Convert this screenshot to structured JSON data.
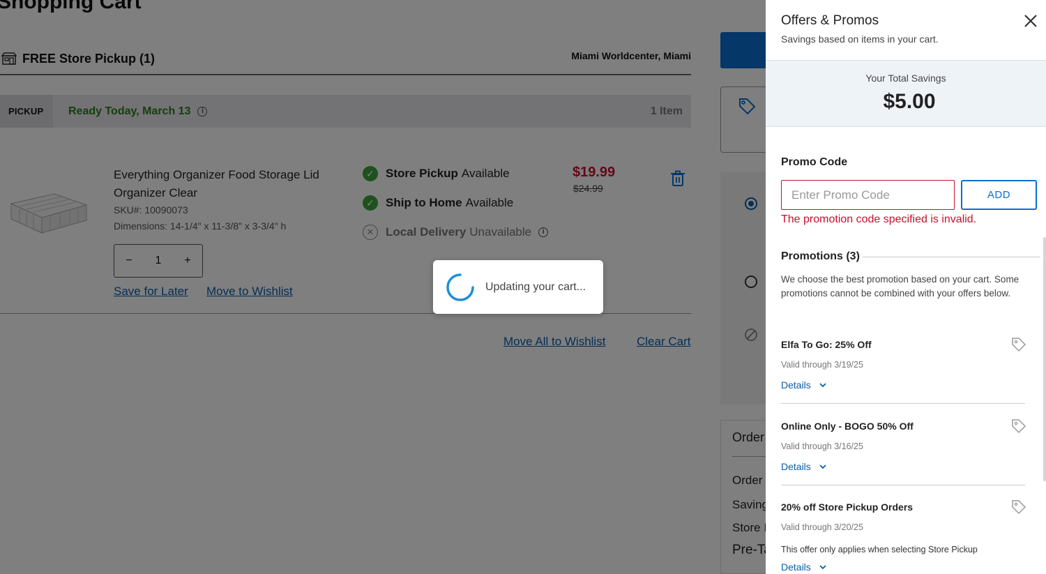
{
  "page": {
    "title": "Shopping Cart",
    "pickup_title": "FREE Store Pickup (1)",
    "store_location": "Miami Worldcenter, Miami",
    "status_tag": "PICKUP",
    "ready_text": "Ready Today, March 13",
    "item_count": "1 Item",
    "product": {
      "name": "Everything Organizer Food Storage Lid Organizer Clear",
      "sku": "SKU#: 10090073",
      "dimensions": "Dimensions: 14-1/4\" x 11-3/8\" x 3-3/4\" h",
      "quantity": "1",
      "price": "$19.99",
      "original_price": "$24.99",
      "save_for_later": "Save for Later",
      "move_to_wishlist": "Move to Wishlist"
    },
    "availability": [
      {
        "option": "Store Pickup",
        "status": "Available"
      },
      {
        "option": "Ship to Home",
        "status": "Available"
      },
      {
        "option": "Local Delivery",
        "status": "Unavailable"
      }
    ],
    "move_all_to_wishlist": "Move All to Wishlist",
    "clear_cart": "Clear Cart",
    "order_summary": {
      "title": "Order",
      "rows": [
        "Order",
        "Saving",
        "Store I",
        "Pre-Ta"
      ]
    }
  },
  "loader": {
    "text": "Updating your cart..."
  },
  "drawer": {
    "title": "Offers & Promos",
    "subtitle": "Savings based on items in your cart.",
    "savings_label": "Your Total Savings",
    "savings_amount": "$5.00",
    "promo_code_label": "Promo Code",
    "promo_placeholder": "Enter Promo Code",
    "promo_value": "",
    "add_button": "ADD",
    "promo_error": "The promotion code specified is invalid.",
    "promotions_heading": "Promotions (3)",
    "promotions_desc": "We choose the best promotion based on your cart. Some promotions cannot be combined with your offers below.",
    "promotions": [
      {
        "name": "Elfa To Go: 25% Off",
        "valid": "Valid through 3/19/25",
        "note": "",
        "details": "Details"
      },
      {
        "name": "Online Only - BOGO 50% Off",
        "valid": "Valid through 3/16/25",
        "note": "",
        "details": "Details"
      },
      {
        "name": "20% off Store Pickup Orders",
        "valid": "Valid through 3/20/25",
        "note": "This offer only applies when selecting Store Pickup",
        "details": "Details"
      }
    ]
  },
  "colors": {
    "brand_blue": "#0a6ed1",
    "sale_red": "#c8102e",
    "ready_green": "#2e7d1f",
    "overlay": "rgba(0,0,0,0.5)"
  },
  "icons": [
    "store-icon",
    "info-icon",
    "check-icon",
    "x-circle-icon",
    "trash-icon",
    "tag-icon",
    "close-icon",
    "chevron-down-icon",
    "spinner-icon",
    "ban-icon"
  ]
}
